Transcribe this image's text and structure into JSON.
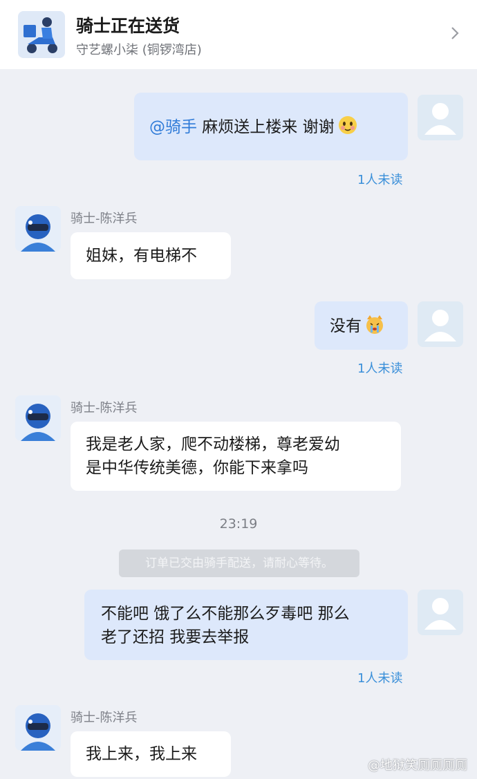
{
  "header": {
    "title": "骑士正在送货",
    "store": "守艺螺小柒 (铜锣湾店)",
    "logo_icon": "rider-scooter-icon",
    "chevron_icon": "chevron-right-icon"
  },
  "messages": [
    {
      "sender": "",
      "mention": "@骑手",
      "text": " 麻烦送上楼来 谢谢",
      "emoji": "blushing-face-emoji",
      "receipt": "1人未读"
    },
    {
      "sender": "骑士-陈洋兵",
      "text": "姐妹，有电梯不"
    },
    {
      "sender": "",
      "text": "没有",
      "emoji": "crying-cat-emoji",
      "receipt": "1人未读"
    },
    {
      "sender": "骑士-陈洋兵",
      "text": "我是老人家，爬不动楼梯，尊老爱幼\n是中华传统美德，你能下来拿吗"
    },
    {
      "sender": "",
      "text": "不能吧 饿了么不能那么歹毒吧 那么\n老了还招 我要去举报",
      "receipt": "1人未读"
    },
    {
      "sender": "骑士-陈洋兵",
      "text": "我上来，我上来"
    }
  ],
  "time_divider": "23:19",
  "system_notice": "订单已交由骑手配送，请耐心等待。",
  "watermark": "@地狱笑厕厕厕厕",
  "colors": {
    "outgoing_bubble": "#dde8fb",
    "incoming_bubble": "#ffffff",
    "receipt": "#3a8fd9",
    "mention": "#2f7bd8"
  }
}
